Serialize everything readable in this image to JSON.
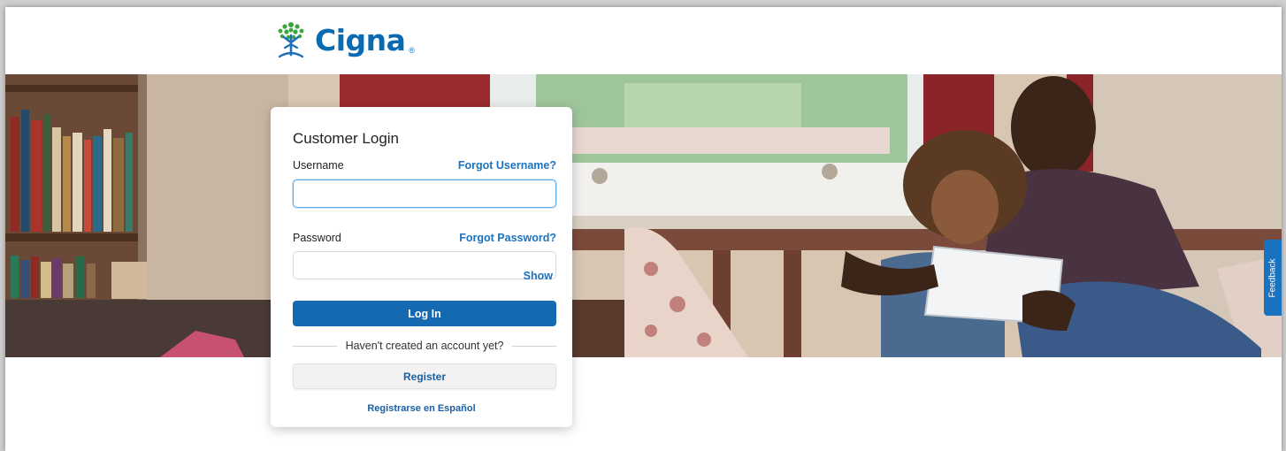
{
  "brand": {
    "name": "Cigna",
    "registered": "®",
    "logo_icon": "tree-of-life-icon",
    "color": "#0a6bb3"
  },
  "login": {
    "title": "Customer Login",
    "username_label": "Username",
    "forgot_username": "Forgot Username?",
    "username_value": "",
    "password_label": "Password",
    "forgot_password": "Forgot Password?",
    "password_value": "",
    "show_label": "Show",
    "login_button": "Log In",
    "divider_text": "Haven't created an account yet?",
    "register_button": "Register",
    "spanish_link": "Registrarse en Español"
  },
  "feedback": {
    "label": "Feedback"
  },
  "colors": {
    "primary_button": "#1469b0",
    "link": "#1a73c1",
    "focus_border": "#5aa9e6"
  }
}
